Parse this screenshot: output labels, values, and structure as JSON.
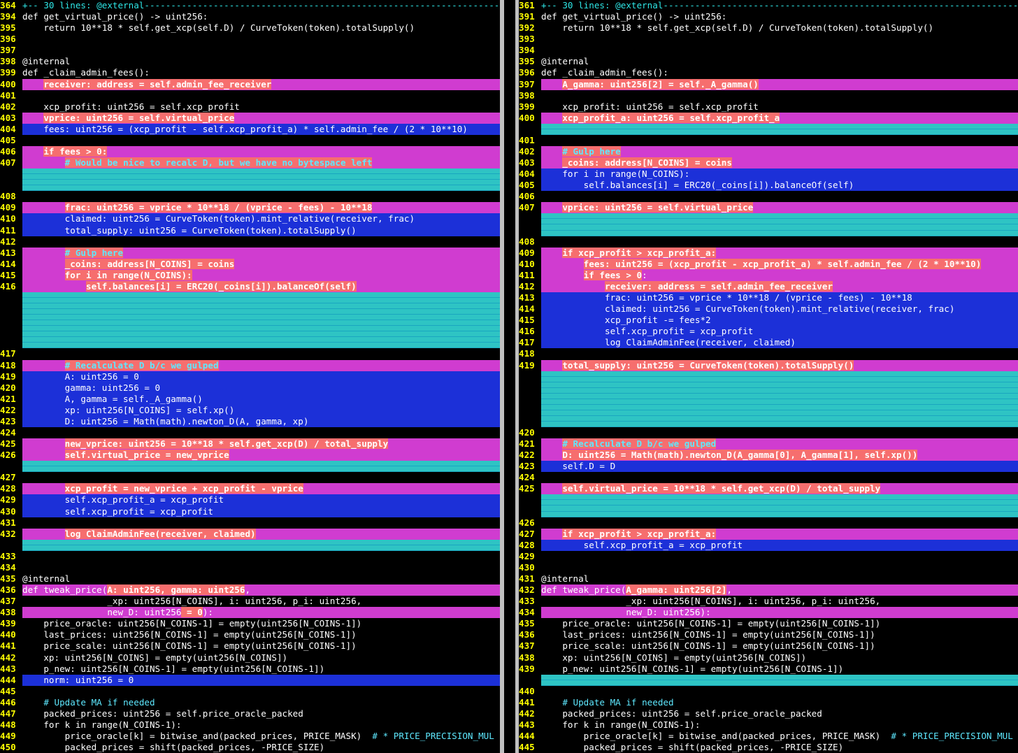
{
  "colors": {
    "background": "#000000",
    "line_number": "#ffff00",
    "added_line": "#d03cd0",
    "changed_line": "#1c30d8",
    "changed_text": "#f66e6e",
    "filler": "#2ec4c4",
    "comment": "#5ee8ff",
    "divider": "#c0c0c0"
  },
  "panes": {
    "left": {
      "fold": {
        "num": "364",
        "text": "+-- 30 lines: @external----------------------------------------------------------------------------------------------------"
      },
      "rows": [
        {
          "n": "394",
          "t": "plain",
          "c": "def get_virtual_price() -> uint256:"
        },
        {
          "n": "395",
          "t": "plain",
          "c": "    return 10**18 * self.get_xcp(self.D) / CurveToken(token).totalSupply()"
        },
        {
          "n": "396",
          "t": "plain",
          "c": ""
        },
        {
          "n": "397",
          "t": "plain",
          "c": ""
        },
        {
          "n": "398",
          "t": "plain",
          "c": "@internal"
        },
        {
          "n": "399",
          "t": "plain",
          "c": "def _claim_admin_fees():"
        },
        {
          "n": "400",
          "t": "add",
          "p": "    ",
          "h": "receiver: address = self.admin_fee_receiver",
          "s": ""
        },
        {
          "n": "401",
          "t": "plain",
          "c": ""
        },
        {
          "n": "402",
          "t": "plain",
          "c": "    xcp_profit: uint256 = self.xcp_profit"
        },
        {
          "n": "403",
          "t": "add",
          "p": "    ",
          "h": "vprice: uint256 = self.virtual_price",
          "s": ""
        },
        {
          "n": "404",
          "t": "chg",
          "c": "    fees: uint256 = (xcp_profit - self.xcp_profit_a) * self.admin_fee / (2 * 10**10)"
        },
        {
          "n": "405",
          "t": "plain",
          "c": ""
        },
        {
          "n": "406",
          "t": "add",
          "p": "    ",
          "h": "if fees > 0:",
          "s": ""
        },
        {
          "n": "407",
          "t": "add",
          "p": "        ",
          "h": "# Would be nice to recalc D, but we have no bytespace left",
          "s": "",
          "cm": true
        },
        {
          "n": "",
          "t": "fill",
          "c": ""
        },
        {
          "n": "",
          "t": "fill",
          "c": ""
        },
        {
          "n": "408",
          "t": "plain",
          "c": ""
        },
        {
          "n": "409",
          "t": "add",
          "p": "        ",
          "h": "frac: uint256 = vprice * 10**18 / (vprice - fees) - 10**18",
          "s": ""
        },
        {
          "n": "410",
          "t": "chg",
          "c": "        claimed: uint256 = CurveToken(token).mint_relative(receiver, frac)"
        },
        {
          "n": "411",
          "t": "chg",
          "c": "        total_supply: uint256 = CurveToken(token).totalSupply()"
        },
        {
          "n": "412",
          "t": "plain",
          "c": ""
        },
        {
          "n": "413",
          "t": "add",
          "p": "        ",
          "h": "# Gulp here",
          "s": "",
          "cm": true
        },
        {
          "n": "414",
          "t": "add",
          "p": "        ",
          "h": "_coins: address[N_COINS] = coins",
          "s": ""
        },
        {
          "n": "415",
          "t": "add",
          "p": "        ",
          "h": "for i in range(N_COINS):",
          "s": ""
        },
        {
          "n": "416",
          "t": "add",
          "p": "            ",
          "h": "self.balances[i] = ERC20(_coins[i]).balanceOf(self)",
          "s": ""
        },
        {
          "n": "",
          "t": "fill",
          "c": ""
        },
        {
          "n": "",
          "t": "fill",
          "c": ""
        },
        {
          "n": "",
          "t": "fill",
          "c": ""
        },
        {
          "n": "",
          "t": "fill",
          "c": ""
        },
        {
          "n": "",
          "t": "fill",
          "c": ""
        },
        {
          "n": "417",
          "t": "plain",
          "c": ""
        },
        {
          "n": "418",
          "t": "add",
          "p": "        ",
          "h": "# Recalculate D b/c we gulped",
          "s": "",
          "cm": true
        },
        {
          "n": "419",
          "t": "chg",
          "c": "        A: uint256 = 0"
        },
        {
          "n": "420",
          "t": "chg",
          "c": "        gamma: uint256 = 0"
        },
        {
          "n": "421",
          "t": "chg",
          "c": "        A, gamma = self._A_gamma()"
        },
        {
          "n": "422",
          "t": "chg",
          "c": "        xp: uint256[N_COINS] = self.xp()"
        },
        {
          "n": "423",
          "t": "chg",
          "c": "        D: uint256 = Math(math).newton_D(A, gamma, xp)"
        },
        {
          "n": "424",
          "t": "plain",
          "c": ""
        },
        {
          "n": "425",
          "t": "add",
          "p": "        ",
          "h": "new_vprice: uint256 = 10**18 * self.get_xcp(D) / total_supply",
          "s": ""
        },
        {
          "n": "426",
          "t": "add",
          "p": "        ",
          "h": "self.virtual_price = new_vprice",
          "s": ""
        },
        {
          "n": "",
          "t": "fill",
          "c": ""
        },
        {
          "n": "427",
          "t": "plain",
          "c": ""
        },
        {
          "n": "428",
          "t": "add",
          "p": "        ",
          "h": "xcp_profit = new_vprice + xcp_profit - vprice",
          "s": ""
        },
        {
          "n": "429",
          "t": "chg",
          "c": "        self.xcp_profit_a = xcp_profit"
        },
        {
          "n": "430",
          "t": "chg",
          "c": "        self.xcp_profit = xcp_profit"
        },
        {
          "n": "431",
          "t": "plain",
          "c": ""
        },
        {
          "n": "432",
          "t": "add",
          "p": "        ",
          "h": "log ClaimAdminFee(receiver, claimed)",
          "s": ""
        },
        {
          "n": "",
          "t": "fill",
          "c": ""
        },
        {
          "n": "433",
          "t": "plain",
          "c": ""
        },
        {
          "n": "434",
          "t": "plain",
          "c": ""
        },
        {
          "n": "435",
          "t": "plain",
          "c": "@internal"
        },
        {
          "n": "436",
          "t": "add",
          "p": "def tweak_price(",
          "h": "A: uint256, gamma: uint256",
          "s": ","
        },
        {
          "n": "437",
          "t": "plain",
          "c": "                _xp: uint256[N_COINS], i: uint256, p_i: uint256,"
        },
        {
          "n": "438",
          "t": "add",
          "p": "                new_D: uint256",
          "h": " = 0",
          "s": "):"
        },
        {
          "n": "439",
          "t": "plain",
          "c": "    price_oracle: uint256[N_COINS-1] = empty(uint256[N_COINS-1])"
        },
        {
          "n": "440",
          "t": "plain",
          "c": "    last_prices: uint256[N_COINS-1] = empty(uint256[N_COINS-1])"
        },
        {
          "n": "441",
          "t": "plain",
          "c": "    price_scale: uint256[N_COINS-1] = empty(uint256[N_COINS-1])"
        },
        {
          "n": "442",
          "t": "plain",
          "c": "    xp: uint256[N_COINS] = empty(uint256[N_COINS])"
        },
        {
          "n": "443",
          "t": "plain",
          "c": "    p_new: uint256[N_COINS-1] = empty(uint256[N_COINS-1])"
        },
        {
          "n": "444",
          "t": "chg",
          "c": "    norm: uint256 = 0"
        },
        {
          "n": "445",
          "t": "plain",
          "c": ""
        },
        {
          "n": "446",
          "t": "cmt",
          "p": "    ",
          "cmt": "# Update MA if needed",
          "s": ""
        },
        {
          "n": "447",
          "t": "plain",
          "c": "    packed_prices: uint256 = self.price_oracle_packed"
        },
        {
          "n": "448",
          "t": "plain",
          "c": "    for k in range(N_COINS-1):"
        },
        {
          "n": "449",
          "t": "cmt",
          "p": "        price_oracle[k] = bitwise_and(packed_prices, PRICE_MASK)  ",
          "cmt": "# * PRICE_PRECISION_MUL",
          "s": ""
        },
        {
          "n": "450",
          "t": "plain",
          "c": "        packed_prices = shift(packed_prices, -PRICE_SIZE)"
        }
      ]
    },
    "right": {
      "fold": {
        "num": "361",
        "text": "+-- 30 lines: @external----------------------------------------------------------------------------------------------------"
      },
      "rows": [
        {
          "n": "391",
          "t": "plain",
          "c": "def get_virtual_price() -> uint256:"
        },
        {
          "n": "392",
          "t": "plain",
          "c": "    return 10**18 * self.get_xcp(self.D) / CurveToken(token).totalSupply()"
        },
        {
          "n": "393",
          "t": "plain",
          "c": ""
        },
        {
          "n": "394",
          "t": "plain",
          "c": ""
        },
        {
          "n": "395",
          "t": "plain",
          "c": "@internal"
        },
        {
          "n": "396",
          "t": "plain",
          "c": "def _claim_admin_fees():"
        },
        {
          "n": "397",
          "t": "add",
          "p": "    ",
          "h": "A_gamma: uint256[2] = self._A_gamma()",
          "s": ""
        },
        {
          "n": "398",
          "t": "plain",
          "c": ""
        },
        {
          "n": "399",
          "t": "plain",
          "c": "    xcp_profit: uint256 = self.xcp_profit"
        },
        {
          "n": "400",
          "t": "add",
          "p": "    ",
          "h": "xcp_profit_a: uint256 = self.xcp_profit_a",
          "s": ""
        },
        {
          "n": "",
          "t": "fill",
          "c": ""
        },
        {
          "n": "401",
          "t": "plain",
          "c": ""
        },
        {
          "n": "402",
          "t": "add",
          "p": "    ",
          "h": "# Gulp here",
          "s": "",
          "cm": true
        },
        {
          "n": "403",
          "t": "add",
          "p": "    ",
          "h": "_coins: address[N_COINS] = coins",
          "s": ""
        },
        {
          "n": "404",
          "t": "chg",
          "c": "    for i in range(N_COINS):"
        },
        {
          "n": "405",
          "t": "chg",
          "c": "        self.balances[i] = ERC20(_coins[i]).balanceOf(self)"
        },
        {
          "n": "406",
          "t": "plain",
          "c": ""
        },
        {
          "n": "407",
          "t": "add",
          "p": "    ",
          "h": "vprice: uint256 = self.virtual_price",
          "s": ""
        },
        {
          "n": "",
          "t": "fill",
          "c": ""
        },
        {
          "n": "",
          "t": "fill",
          "c": ""
        },
        {
          "n": "408",
          "t": "plain",
          "c": ""
        },
        {
          "n": "409",
          "t": "add",
          "p": "    ",
          "h": "if xcp_profit > xcp_profit_a:",
          "s": ""
        },
        {
          "n": "410",
          "t": "add",
          "p": "        ",
          "h": "fees: uint256 = (xcp_profit - xcp_profit_a) * self.admin_fee / (2 * 10**10)",
          "s": ""
        },
        {
          "n": "411",
          "t": "add",
          "p": "        ",
          "h": "if fees > 0",
          "s": ":"
        },
        {
          "n": "412",
          "t": "add",
          "p": "            ",
          "h": "receiver: address = self.admin_fee_receiver",
          "s": ""
        },
        {
          "n": "413",
          "t": "chg",
          "c": "            frac: uint256 = vprice * 10**18 / (vprice - fees) - 10**18"
        },
        {
          "n": "414",
          "t": "chg",
          "c": "            claimed: uint256 = CurveToken(token).mint_relative(receiver, frac)"
        },
        {
          "n": "415",
          "t": "chg",
          "c": "            xcp_profit -= fees*2"
        },
        {
          "n": "416",
          "t": "chg",
          "c": "            self.xcp_profit = xcp_profit"
        },
        {
          "n": "417",
          "t": "chg",
          "c": "            log ClaimAdminFee(receiver, claimed)"
        },
        {
          "n": "418",
          "t": "plain",
          "c": ""
        },
        {
          "n": "419",
          "t": "add",
          "p": "    ",
          "h": "total_supply: uint256 = CurveToken(token).totalSupply()",
          "s": ""
        },
        {
          "n": "",
          "t": "fill",
          "c": ""
        },
        {
          "n": "",
          "t": "fill",
          "c": ""
        },
        {
          "n": "",
          "t": "fill",
          "c": ""
        },
        {
          "n": "",
          "t": "fill",
          "c": ""
        },
        {
          "n": "",
          "t": "fill",
          "c": ""
        },
        {
          "n": "420",
          "t": "plain",
          "c": ""
        },
        {
          "n": "421",
          "t": "add",
          "p": "    ",
          "h": "# Recalculate D b/c we gulped",
          "s": "",
          "cm": true
        },
        {
          "n": "422",
          "t": "add",
          "p": "    ",
          "h": "D: uint256 = Math(math).newton_D(A_gamma[0], A_gamma[1], self.xp())",
          "s": ""
        },
        {
          "n": "423",
          "t": "chg",
          "c": "    self.D = D"
        },
        {
          "n": "424",
          "t": "plain",
          "c": ""
        },
        {
          "n": "425",
          "t": "add",
          "p": "    ",
          "h": "self.virtual_price = 10**18 * self.get_xcp(D) / total_supply",
          "s": ""
        },
        {
          "n": "",
          "t": "fill",
          "c": ""
        },
        {
          "n": "",
          "t": "fill",
          "c": ""
        },
        {
          "n": "426",
          "t": "plain",
          "c": ""
        },
        {
          "n": "427",
          "t": "add",
          "p": "    ",
          "h": "if xcp_profit > xcp_profit_a:",
          "s": ""
        },
        {
          "n": "428",
          "t": "chg",
          "c": "        self.xcp_profit_a = xcp_profit"
        },
        {
          "n": "429",
          "t": "plain",
          "c": ""
        },
        {
          "n": "430",
          "t": "plain",
          "c": ""
        },
        {
          "n": "431",
          "t": "plain",
          "c": "@internal"
        },
        {
          "n": "432",
          "t": "add",
          "p": "def tweak_price(",
          "h": "A_gamma: uint256[2]",
          "s": ","
        },
        {
          "n": "433",
          "t": "plain",
          "c": "                _xp: uint256[N_COINS], i: uint256, p_i: uint256,"
        },
        {
          "n": "434",
          "t": "add",
          "p": "                new_D: uint256",
          "h": "",
          "s": "):"
        },
        {
          "n": "435",
          "t": "plain",
          "c": "    price_oracle: uint256[N_COINS-1] = empty(uint256[N_COINS-1])"
        },
        {
          "n": "436",
          "t": "plain",
          "c": "    last_prices: uint256[N_COINS-1] = empty(uint256[N_COINS-1])"
        },
        {
          "n": "437",
          "t": "plain",
          "c": "    price_scale: uint256[N_COINS-1] = empty(uint256[N_COINS-1])"
        },
        {
          "n": "438",
          "t": "plain",
          "c": "    xp: uint256[N_COINS] = empty(uint256[N_COINS])"
        },
        {
          "n": "439",
          "t": "plain",
          "c": "    p_new: uint256[N_COINS-1] = empty(uint256[N_COINS-1])"
        },
        {
          "n": "",
          "t": "fill",
          "c": ""
        },
        {
          "n": "440",
          "t": "plain",
          "c": ""
        },
        {
          "n": "441",
          "t": "cmt",
          "p": "    ",
          "cmt": "# Update MA if needed",
          "s": ""
        },
        {
          "n": "442",
          "t": "plain",
          "c": "    packed_prices: uint256 = self.price_oracle_packed"
        },
        {
          "n": "443",
          "t": "plain",
          "c": "    for k in range(N_COINS-1):"
        },
        {
          "n": "444",
          "t": "cmt",
          "p": "        price_oracle[k] = bitwise_and(packed_prices, PRICE_MASK)  ",
          "cmt": "# * PRICE_PRECISION_MUL",
          "s": ""
        },
        {
          "n": "445",
          "t": "plain",
          "c": "        packed_prices = shift(packed_prices, -PRICE_SIZE)"
        }
      ]
    }
  }
}
